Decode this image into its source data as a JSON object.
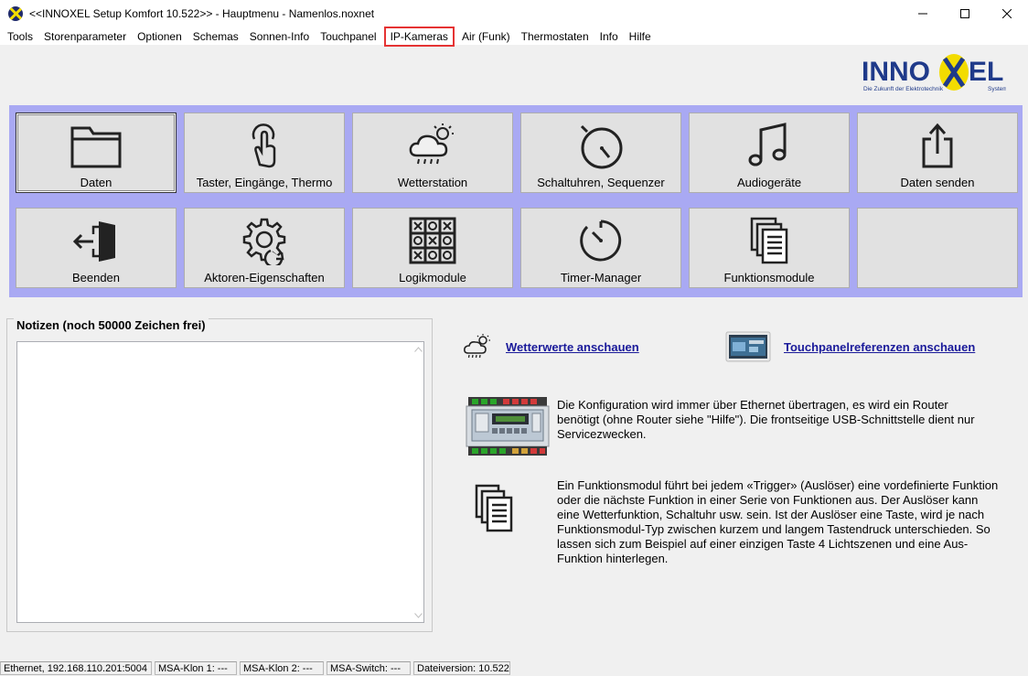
{
  "window": {
    "title": "<<INNOXEL Setup Komfort 10.522>>  -  Hauptmenu  -  Namenlos.noxnet",
    "minimize": "—",
    "maximize": "☐",
    "close": "✕"
  },
  "menu": {
    "items": [
      "Tools",
      "Storenparameter",
      "Optionen",
      "Schemas",
      "Sonnen-Info",
      "Touchpanel",
      "IP-Kameras",
      "Air (Funk)",
      "Thermostaten",
      "Info",
      "Hilfe"
    ],
    "highlighted": "IP-Kameras",
    "highlight_color": "#e53333"
  },
  "logo": {
    "brand": "INNOXEL",
    "tagline": "Die Zukunft der Elektrotechnik",
    "sub": "System",
    "colors": {
      "text": "#1f3a8a",
      "x": "#f3dc00"
    }
  },
  "tiles": [
    {
      "label": "Daten",
      "icon": "folder-icon"
    },
    {
      "label": "Taster, Eingänge, Thermo",
      "icon": "touch-icon"
    },
    {
      "label": "Wetterstation",
      "icon": "weather-icon"
    },
    {
      "label": "Schaltuhren, Sequenzer",
      "icon": "stopwatch-icon"
    },
    {
      "label": "Audiogeräte",
      "icon": "music-note-icon"
    },
    {
      "label": "Daten senden",
      "icon": "share-icon"
    },
    {
      "label": "Beenden",
      "icon": "exit-door-icon"
    },
    {
      "label": "Aktoren-Eigenschaften",
      "icon": "gear-refresh-icon"
    },
    {
      "label": "Logikmodule",
      "icon": "grid-logic-icon"
    },
    {
      "label": "Timer-Manager",
      "icon": "timer-icon"
    },
    {
      "label": "Funktionsmodule",
      "icon": "documents-icon"
    },
    {
      "label": "",
      "icon": ""
    }
  ],
  "panel_color": "#a9a9f3",
  "notes": {
    "title": "Notizen (noch 50000 Zeichen frei)",
    "value": ""
  },
  "links": {
    "weather": "Wetterwerte anschauen",
    "touchpanel": "Touchpanelreferenzen anschauen"
  },
  "info": {
    "ethernet_text": "Die Konfiguration wird immer über Ethernet übertragen, es wird ein Router benötigt (ohne Router siehe \"Hilfe\"). Die frontseitige USB-Schnittstelle dient nur Servicezwecken.",
    "function_text": "Ein Funktionsmodul führt bei jedem «Trigger» (Auslöser) eine vordefinierte Funktion oder die nächste Funktion in einer Serie von Funktionen aus. Der Auslöser kann eine Wetterfunktion, Schaltuhr usw. sein. Ist der Auslöser eine Taste, wird je nach Funktionsmodul-Typ zwischen kurzem und langem Tastendruck unterschieden. So lassen sich zum Beispiel auf einer einzigen Taste 4 Lichtszenen und eine Aus-Funktion hinterlegen."
  },
  "status": {
    "ethernet": "Ethernet, 192.168.110.201:5004",
    "klon1": "MSA-Klon 1: ---",
    "klon2": "MSA-Klon 2: ---",
    "switch": "MSA-Switch: ---",
    "version": "Dateiversion: 10.522"
  }
}
